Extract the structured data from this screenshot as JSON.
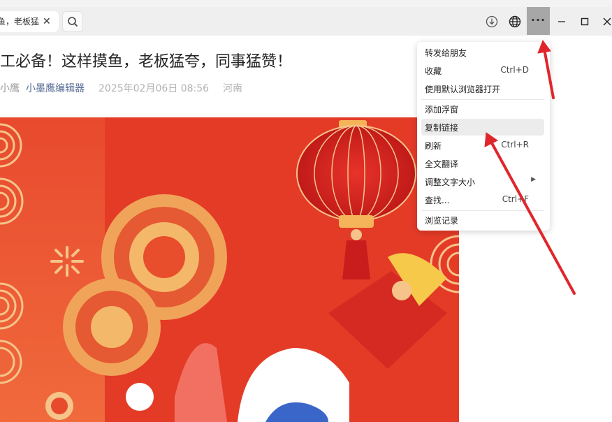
{
  "tab": {
    "title": "鱼，老板猛",
    "close_glyph": "✕"
  },
  "toolbar": {
    "search_icon": "search-icon",
    "download_icon": "download-icon",
    "globe_icon": "globe-icon",
    "more_label": "···"
  },
  "window": {
    "minimize": "minimize-icon",
    "maximize": "maximize-icon",
    "close": "close-icon"
  },
  "article": {
    "title": "工必备！这样摸鱼，老板猛夸，同事猛赞！",
    "author": "小鹰",
    "account": "小墨鹰编辑器",
    "date": "2025年02月06日 08:56",
    "location": "河南"
  },
  "menu": {
    "items": [
      {
        "label": "转发给朋友",
        "shortcut": ""
      },
      {
        "label": "收藏",
        "shortcut": "Ctrl+D"
      },
      {
        "label": "使用默认浏览器打开",
        "shortcut": ""
      },
      {
        "label": "添加浮窗",
        "shortcut": ""
      },
      {
        "label": "复制链接",
        "shortcut": "",
        "highlighted": true
      },
      {
        "label": "刷新",
        "shortcut": "Ctrl+R"
      },
      {
        "label": "全文翻译",
        "shortcut": ""
      },
      {
        "label": "调整文字大小",
        "shortcut": "",
        "submenu": true
      },
      {
        "label": "查找...",
        "shortcut": "Ctrl+F"
      },
      {
        "label": "浏览记录",
        "shortcut": ""
      }
    ],
    "submenu_arrow": "▶"
  },
  "colors": {
    "accent_link": "#576b95",
    "annotation_arrow": "#e0262c",
    "hero_red": "#e8432c",
    "menu_highlight": "#ececec"
  }
}
